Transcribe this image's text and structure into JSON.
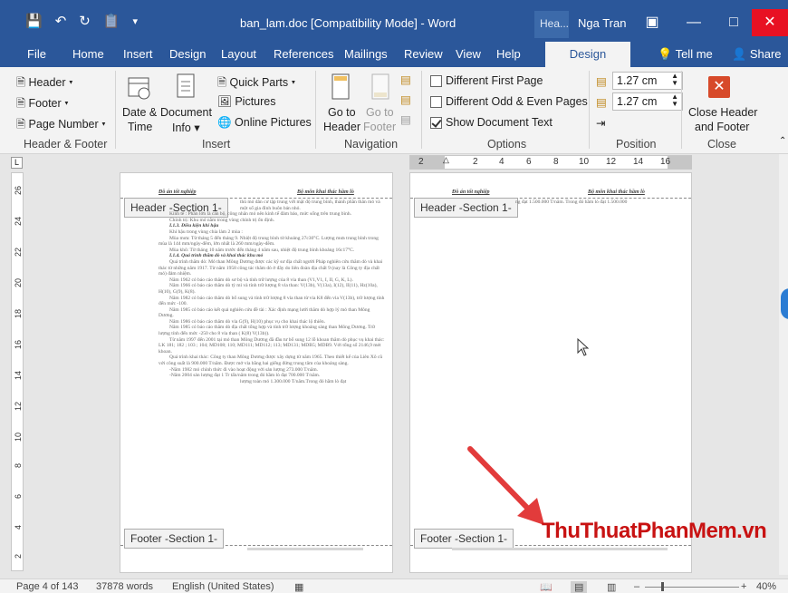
{
  "window": {
    "title": "ban_lam.doc [Compatibility Mode]  -  Word",
    "context_tab": "Hea...",
    "user": "Nga Tran"
  },
  "tabs": [
    "File",
    "Home",
    "Insert",
    "Design",
    "Layout",
    "References",
    "Mailings",
    "Review",
    "View",
    "Help",
    "Design"
  ],
  "tell_me": "Tell me",
  "share": "Share",
  "ribbon": {
    "header": "Header",
    "footer": "Footer",
    "page_number": "Page Number",
    "group_header_footer": "Header & Footer",
    "date_time_1": "Date &",
    "date_time_2": "Time",
    "document_info_1": "Document",
    "document_info_2": "Info",
    "quick_parts": "Quick Parts",
    "pictures": "Pictures",
    "online_pictures": "Online Pictures",
    "group_insert": "Insert",
    "goto_header_1": "Go to",
    "goto_header_2": "Header",
    "goto_footer_1": "Go to",
    "goto_footer_2": "Footer",
    "group_navigation": "Navigation",
    "different_first_page": "Different First Page",
    "different_odd_even": "Different Odd & Even Pages",
    "show_document_text": "Show Document Text",
    "group_options": "Options",
    "header_from_top": "1.27 cm",
    "footer_from_bottom": "1.27 cm",
    "group_position": "Position",
    "close_1": "Close Header",
    "close_2": "and Footer",
    "group_close": "Close"
  },
  "hruler_numbers": [
    "2",
    "2",
    "4",
    "6",
    "8",
    "10",
    "12",
    "14",
    "16"
  ],
  "vruler_numbers": [
    "26",
    "24",
    "22",
    "20",
    "18",
    "16",
    "14",
    "12",
    "10",
    "8",
    "6",
    "4",
    "2"
  ],
  "page1": {
    "header_tag": "Header -Section 1-",
    "footer_tag": "Footer -Section 1-",
    "header_left": "Đồ án tốt nghiệp",
    "header_right": "Bộ môn khai thác hầm lò",
    "lines": [
      "Kinh tế : Phần lớn là cán bộ, công nhân mỏ nên kinh tế đảm bảo, mức sống trên trung bình.",
      "Chính trị: Khu mỏ nằm trong vùng chính trị ổn định.",
      "I.1.3. Điều kiện khí hậu",
      "Khí hậu trong vùng chia làm 2 mùa :",
      "Mùa mưa: Từ tháng 5 đến tháng 9. Nhiệt độ trung bình từ khoảng 27c30°C. Lượng mưa trung bình trong mùa là 144 mm/ngày-đêm, lớn nhất là 260 mm/ngày-đêm.",
      "Mùa khô: Từ tháng 10 năm trước đến tháng 4 năm sau, nhiệt độ trung bình khoảng 16c17°C.",
      "I.1.4. Quá trình thăm dò và khai thác khu mỏ",
      "Quá trình thăm dò: Mỏ than Mông Dương được các kỹ sư địa chất người Pháp nghiên cứu thăm dò và khai thác từ những năm 1917. Từ năm 1958 công tác thăm dò ở đây do liên đoàn địa chất 9 (nay là Công ty địa chất mỏ) đảm nhiệm.",
      "Năm 1962 có báo cáo thăm dò sơ bộ và tính trữ lượng của 8 vỉa than (V1,V1, I, II, G, K, L).",
      "Năm 1966 có báo cáo thăm dò tỷ mỉ và tính trữ lượng 8 vỉa than: V(13b), V(13a), I(12), II(11), Hz(10a), H(10), G(9), K(8).",
      "Năm 1982 có báo cáo thăm dò bổ sung và tính trữ lượng 8 vỉa than từ vỉa K8 đến vỉa V(13b), trữ lượng tính đến mức -100.",
      "Năm 1985 có báo cáo kết quả nghiên cứu đề tài : Xác định mạng lưới thăm dò hợp lý mỏ than Mông Dương.",
      "Năm 1986 có báo cáo thăm dò vỉa G(9), H(10) phục vụ cho khai thác lộ thiên.",
      "Năm 1985 có báo cáo thăm dò địa chất tổng hợp và tính trữ lượng khoáng sàng than Mông Dương. Trữ lượng tính đến mức -250 cho 8 vỉa than ( K(8) V(13b)).",
      "Từ năm 1997 đến 2001 tại mỏ than Mông Dương đã đầu tư bổ sung 12 lỗ khoan thăm dò phục vụ khai thác: LK 181; 182 ; 103 ; 104; MD108; 110; MD111; MD112; 113; MD131; MDB5; MDB9. Với tổng số 2146,9 mét khoan.",
      "Quá trình khai thác: Công ty than Mông Dương được xây dựng từ năm 1965. Theo thiết kế của Liên Xô cũ với công suất là 900.000 T/năm. Được mở vỉa bằng hai giếng đứng trung tâm của khoáng sàng.",
      "-Năm 1982 mỏ chính thức đi vào hoạt động với sản lượng 273.000 T/năm.",
      "-Năm 2004 sản lượng đạt 1 Tr tấn/năm trong đó hầm lò đạt 700.000 T/năm.",
      "lượng toàn mỏ 1.300.000 T/năm.Trong đó hầm lò đạt"
    ]
  },
  "page2": {
    "header_tag": "Header -Section 1-",
    "footer_tag": "Footer -Section 1-",
    "header_left": "Đồ án tốt nghiệp",
    "header_right": "Bộ môn khai thác hầm lò",
    "first_line": "ng đạt 1.500.000 T/năm. Trong đó hầm lò đạt 1.500.000"
  },
  "statusbar": {
    "page": "Page 4 of 143",
    "words": "37878 words",
    "language": "English (United States)",
    "zoom": "40%"
  },
  "watermark": "ThuThuatPhanMem.vn",
  "colors": {
    "titlebar": "#2b579a",
    "close": "#e81123",
    "watermark": "#c81212"
  }
}
